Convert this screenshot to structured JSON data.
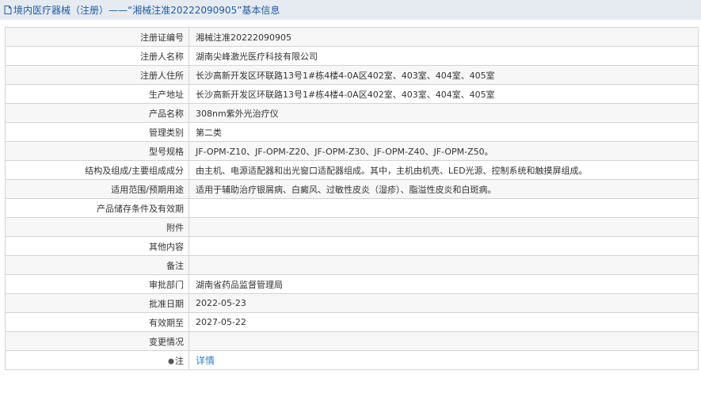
{
  "header": {
    "title": "境内医疗器械（注册）——“湘械注准20222090905”基本信息"
  },
  "rows": [
    {
      "label": "注册证编号",
      "value": "湘械注准20222090905"
    },
    {
      "label": "注册人名称",
      "value": "湖南尖峰激光医疗科技有限公司"
    },
    {
      "label": "注册人住所",
      "value": "长沙高新开发区环联路13号1#栋4楼4-0A区402室、403室、404室、405室"
    },
    {
      "label": "生产地址",
      "value": "长沙高新开发区环联路13号1#栋4楼4-0A区402室、403室、404室、405室"
    },
    {
      "label": "产品名称",
      "value": "308nm紫外光治疗仪"
    },
    {
      "label": "管理类别",
      "value": "第二类"
    },
    {
      "label": "型号规格",
      "value": "JF-OPM-Z10、JF-OPM-Z20、JF-OPM-Z30、JF-OPM-Z40、JF-OPM-Z50。"
    },
    {
      "label": "结构及组成/主要组成成分",
      "value": "由主机、电源适配器和出光窗口适配器组成。其中，主机由机壳、LED光源、控制系统和触摸屏组成。"
    },
    {
      "label": "适用范围/预期用途",
      "value": "适用于辅助治疗银屑病、白癜风、过敏性皮炎（湿疹）、脂溢性皮炎和白斑病。"
    },
    {
      "label": "产品储存条件及有效期",
      "value": ""
    },
    {
      "label": "附件",
      "value": ""
    },
    {
      "label": "其他内容",
      "value": ""
    },
    {
      "label": "备注",
      "value": ""
    },
    {
      "label": "审批部门",
      "value": "湖南省药品监督管理局"
    },
    {
      "label": "批准日期",
      "value": "2022-05-23"
    },
    {
      "label": "有效期至",
      "value": "2027-05-22"
    },
    {
      "label": "变更情况",
      "value": ""
    }
  ],
  "note_row": {
    "label": "注",
    "icon": "pin-icon",
    "link_text": "详情"
  },
  "colors": {
    "title_background": "#e6ebf1",
    "title_text": "#1f5aa6",
    "border": "#d3d3d3",
    "link": "#3a7fc4"
  }
}
